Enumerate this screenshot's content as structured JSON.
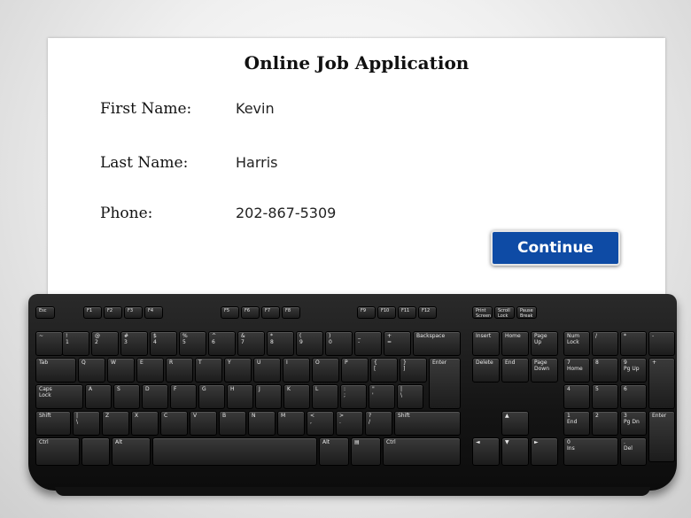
{
  "form": {
    "title": "Online Job Application",
    "fields": [
      {
        "label": "First Name:",
        "value": "Kevin"
      },
      {
        "label": "Last Name:",
        "value": "Harris"
      },
      {
        "label": "Phone:",
        "value": "202-867-5309"
      }
    ],
    "continue_label": "Continue"
  },
  "colors": {
    "button_bg": "#0e4ba5",
    "keyboard_bg": "#1a1a1a",
    "background": "#ffffff"
  },
  "keyboard": {
    "keys": [
      "Esc",
      "F1",
      "F2",
      "F3",
      "F4",
      "F5",
      "F6",
      "F7",
      "F8",
      "F9",
      "F10",
      "F11",
      "F12",
      "Print\nScreen",
      "Scroll\nLock",
      "Pause\nBreak",
      "~",
      "!\n1",
      "@\n2",
      "#\n3",
      "$\n4",
      "%\n5",
      "^\n6",
      "&\n7",
      "*\n8",
      "(\n9",
      ")\n0",
      "_\n-",
      "+\n=",
      "Backspace",
      "Insert",
      "Home",
      "Page\nUp",
      "Num\nLock",
      "/",
      "*",
      "-",
      "Tab",
      "Q",
      "W",
      "E",
      "R",
      "T",
      "Y",
      "U",
      "I",
      "O",
      "P",
      "{\n[",
      "}\n]",
      "Enter",
      "Delete",
      "End",
      "Page\nDown",
      "7\nHome",
      "8",
      "9\nPg Up",
      "+",
      "Caps\nLock",
      "A",
      "S",
      "D",
      "F",
      "G",
      "H",
      "J",
      "K",
      "L",
      ":\n;",
      "\"\n'",
      "|\n\\",
      "4",
      "5",
      "6",
      "Shift",
      "|\n\\",
      "Z",
      "X",
      "C",
      "V",
      "B",
      "N",
      "M",
      "<\n,",
      ">\n.",
      "?\n/",
      "Shift",
      "▲",
      "1\nEnd",
      "2",
      "3\nPg Dn",
      "Enter",
      "Ctrl",
      "",
      "Alt",
      "",
      "Alt",
      "▤",
      "Ctrl",
      "◄",
      "▼",
      "►",
      "0\nIns",
      ".\nDel"
    ]
  }
}
